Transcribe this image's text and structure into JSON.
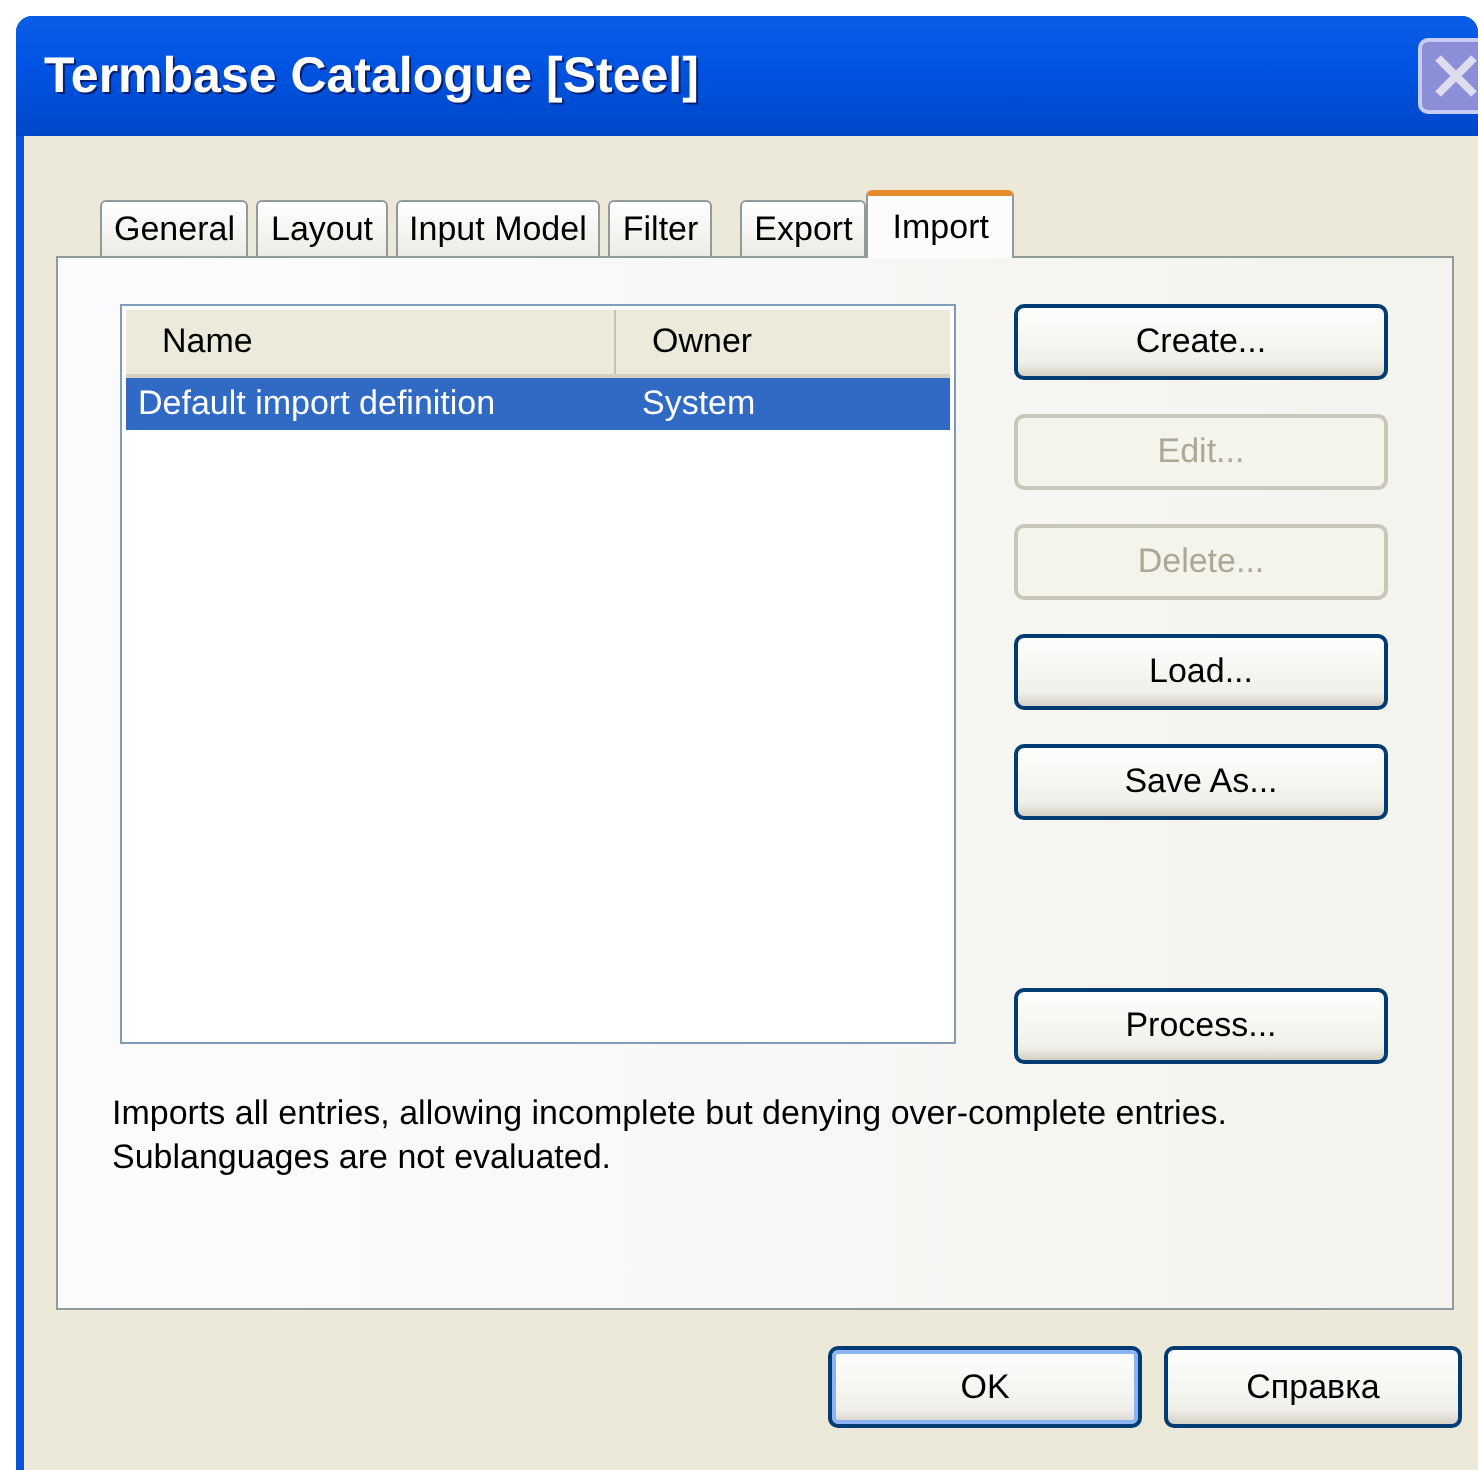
{
  "window": {
    "title": "Termbase Catalogue [Steel]"
  },
  "tabs": [
    {
      "label": "General",
      "selected": false
    },
    {
      "label": "Layout",
      "selected": false
    },
    {
      "label": "Input Model",
      "selected": false
    },
    {
      "label": "Filter",
      "selected": false
    },
    {
      "label": "Export",
      "selected": false
    },
    {
      "label": "Import",
      "selected": true
    }
  ],
  "list": {
    "columns": [
      "Name",
      "Owner"
    ],
    "rows": [
      {
        "cells": [
          "Default import definition",
          "System"
        ],
        "selected": true
      }
    ]
  },
  "buttons": [
    {
      "label": "Create...",
      "disabled": false
    },
    {
      "label": "Edit...",
      "disabled": true
    },
    {
      "label": "Delete...",
      "disabled": true
    },
    {
      "label": "Load...",
      "disabled": false
    },
    {
      "label": "Save As...",
      "disabled": false
    },
    {
      "label": "Process...",
      "disabled": false
    }
  ],
  "description": "Imports all entries, allowing incomplete but denying over-complete entries. Sublanguages are not evaluated.",
  "footer_buttons": [
    {
      "label": "OK",
      "default": true
    },
    {
      "label": "Справка",
      "default": false
    }
  ]
}
